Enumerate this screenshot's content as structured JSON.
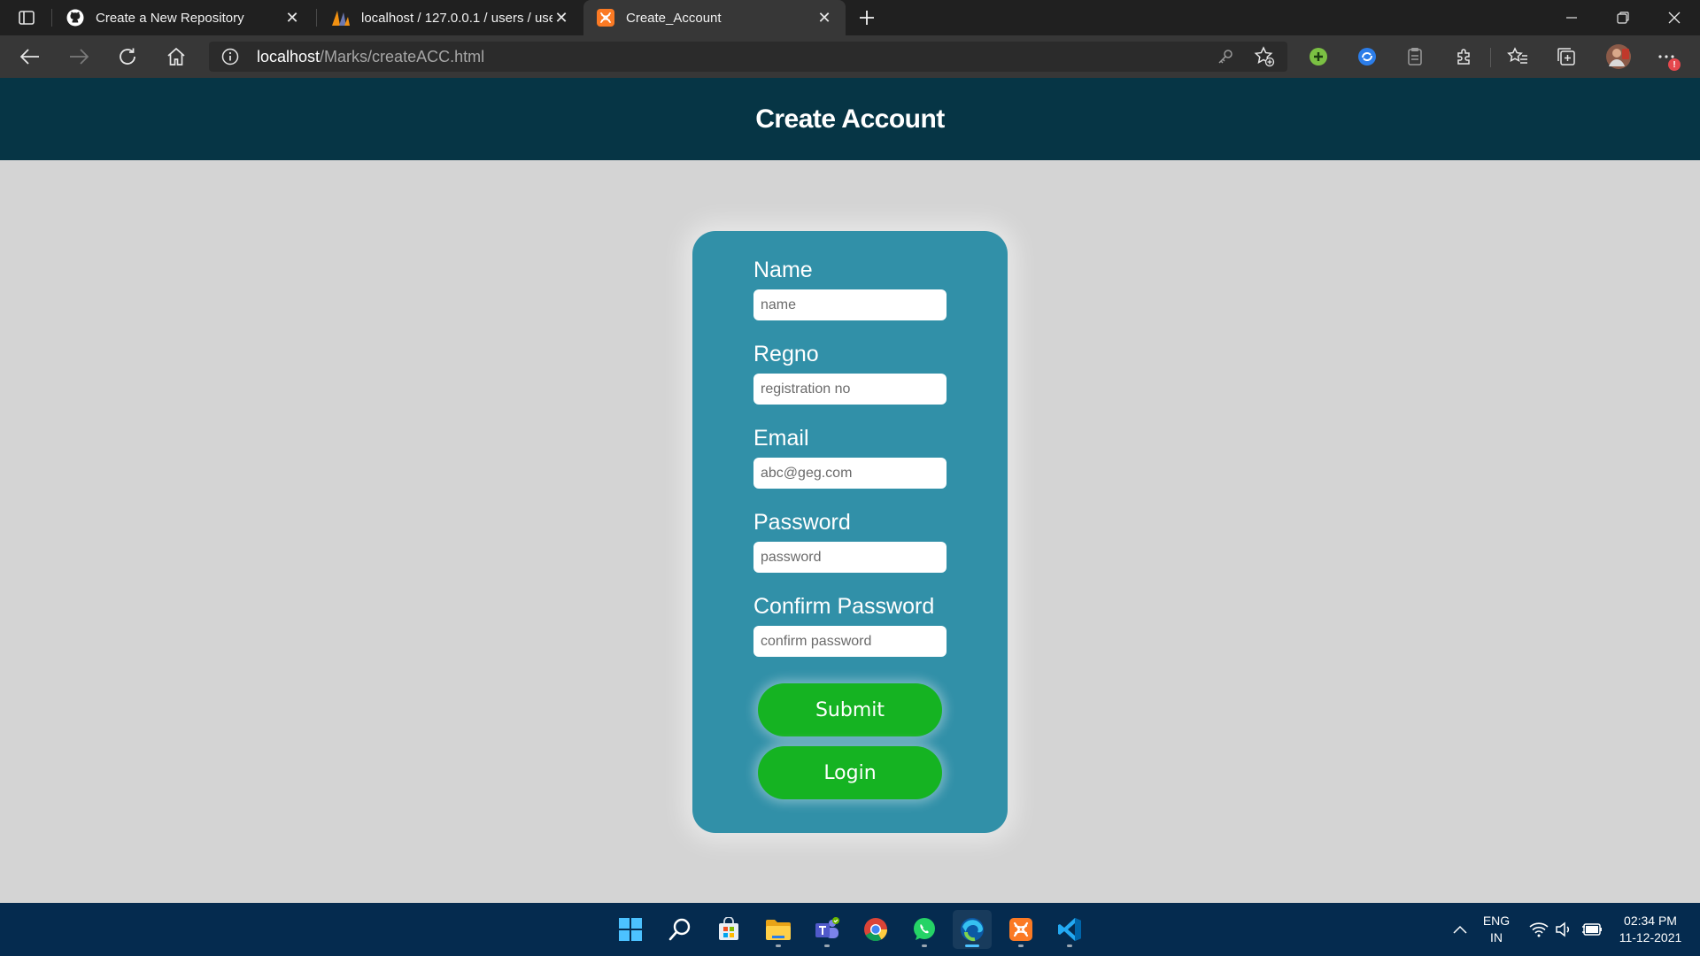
{
  "browser": {
    "tabs": [
      {
        "title": "Create a New Repository",
        "favicon": "github-icon"
      },
      {
        "title": "localhost / 127.0.0.1 / users / use",
        "favicon": "phpmyadmin-icon"
      },
      {
        "title": "Create_Account",
        "favicon": "xampp-icon",
        "active": true
      }
    ],
    "address": {
      "host": "localhost",
      "path": "/Marks/createACC.html"
    },
    "notification_badge": "!"
  },
  "page": {
    "title": "Create Account",
    "form": {
      "name": {
        "label": "Name",
        "placeholder": "name"
      },
      "regno": {
        "label": "Regno",
        "placeholder": "registration no"
      },
      "email": {
        "label": "Email",
        "placeholder": "abc@geg.com"
      },
      "password": {
        "label": "Password",
        "placeholder": "password"
      },
      "confirm_password": {
        "label": "Confirm Password",
        "placeholder": "confirm password"
      },
      "submit_label": "Submit",
      "login_label": "Login"
    }
  },
  "taskbar": {
    "apps": [
      "start-icon",
      "search-icon",
      "store-icon",
      "file-explorer-icon",
      "teams-icon",
      "chrome-icon",
      "whatsapp-icon",
      "edge-icon",
      "xampp-icon",
      "vscode-icon"
    ],
    "language": "ENG",
    "region": "IN",
    "time": "02:34 PM",
    "date": "11-12-2021"
  },
  "colors": {
    "header": "#063545",
    "card": "#3190a8",
    "button": "#15b322",
    "background": "#d4d4d4",
    "taskbar": "#052b4f"
  }
}
